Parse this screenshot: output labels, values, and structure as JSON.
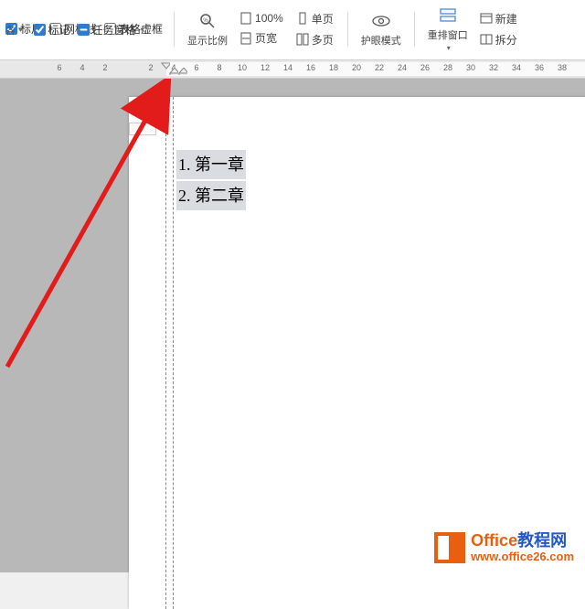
{
  "ribbon": {
    "row1": {
      "ruler": "标尺",
      "gridlines": "网格线",
      "table_frame": "表格虚框",
      "ruler_checked": true,
      "gridlines_checked": false,
      "table_frame_checked": false
    },
    "row2": {
      "marks": "标记",
      "taskpane": "任务窗格",
      "cut_left": "各",
      "marks_checked": true,
      "taskpane_indeterminate": true
    },
    "zoom_group": {
      "zoom_ratio_label": "显示比例",
      "hundred": "100%",
      "page_width": "页宽",
      "single_page": "单页",
      "multi_page": "多页"
    },
    "eye_mode": "护眼模式",
    "rearrange": "重排窗口",
    "new_window": "新建",
    "split": "拆分"
  },
  "ruler_numbers": [
    "6",
    "4",
    "2",
    "2",
    "4",
    "6",
    "8",
    "10",
    "12",
    "14",
    "16",
    "18",
    "20",
    "22",
    "24",
    "26",
    "28",
    "30",
    "32",
    "34",
    "36",
    "38"
  ],
  "document": {
    "line1_num": "1.",
    "line1_text": "第一章",
    "line2_num": "2.",
    "line2_text": "第二章"
  },
  "watermark": {
    "brand_en": "Office",
    "brand_cn": "教程网",
    "url": "www.office26.com"
  }
}
